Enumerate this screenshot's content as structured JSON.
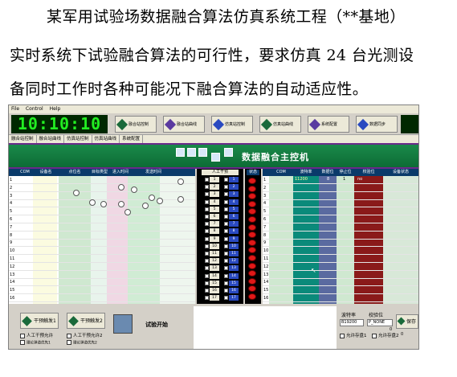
{
  "doc": {
    "line1": "某军用试验场数据融合算法仿真系统工程（**基地）",
    "line2": "实时系统下试验融合算法的可行性，要求仿真 24 台光测设",
    "line3": "备同时工作时各种可能况下融合算法的自动适应性。"
  },
  "menu": [
    "File",
    "Control",
    "Help"
  ],
  "clock": "10:10:10",
  "toolbar": [
    "融合站控制",
    "融合站曲线",
    "仿真站控制",
    "仿真站曲线",
    "系统配置",
    "数据同步"
  ],
  "tabs": [
    "融合站控制",
    "融合站曲线",
    "仿真站控制",
    "仿真站曲线",
    "系统配置"
  ],
  "banner_title": "数据融合主控机",
  "left_table": {
    "headers": [
      "COM",
      "设备名",
      "点位名",
      "目标类型",
      "进入时间",
      "发送时间"
    ],
    "rows": [
      "1",
      "2",
      "3",
      "4",
      "5",
      "6",
      "7",
      "8",
      "9",
      "10",
      "11",
      "12",
      "13",
      "14",
      "15",
      "16"
    ]
  },
  "manual_panel": {
    "title": "人工干预",
    "left_nums": [
      "1",
      "2",
      "3",
      "4",
      "5",
      "6",
      "7",
      "8",
      "9",
      "10",
      "11",
      "12",
      "13",
      "14",
      "15",
      "16",
      "17"
    ],
    "right_nums": [
      "1",
      "2",
      "3",
      "4",
      "5",
      "6",
      "7",
      "8",
      "9",
      "10",
      "11",
      "12",
      "13",
      "14",
      "15",
      "16",
      "17"
    ]
  },
  "status_header": "状态",
  "right_table": {
    "headers": [
      "COM",
      "波特率",
      "数据位",
      "停止位",
      "校验位",
      "设备状态"
    ],
    "rows": [
      "1",
      "2",
      "3",
      "4",
      "5",
      "6",
      "7",
      "8",
      "9",
      "10",
      "11",
      "12",
      "13",
      "14",
      "15",
      "16"
    ],
    "row1": {
      "baud": "11200",
      "data": "8",
      "stop": "1",
      "parity": "no"
    }
  },
  "bottom": {
    "btn1": "干预触发1",
    "btn2": "干预触发2",
    "chk1": "人工干预允许",
    "chk2": "人工干预允许2",
    "chk3": "理论弹道优先1",
    "chk4": "理论弹道优先2",
    "start": "试验开始",
    "baud_label": "波特率",
    "parity_label": "校验位",
    "baud_value": "B19200",
    "parity_value": "P_NONE",
    "save": "保存",
    "chk5": "允许存盘1",
    "chk6": "允许存盘2",
    "num1": "0",
    "num2": "0"
  }
}
